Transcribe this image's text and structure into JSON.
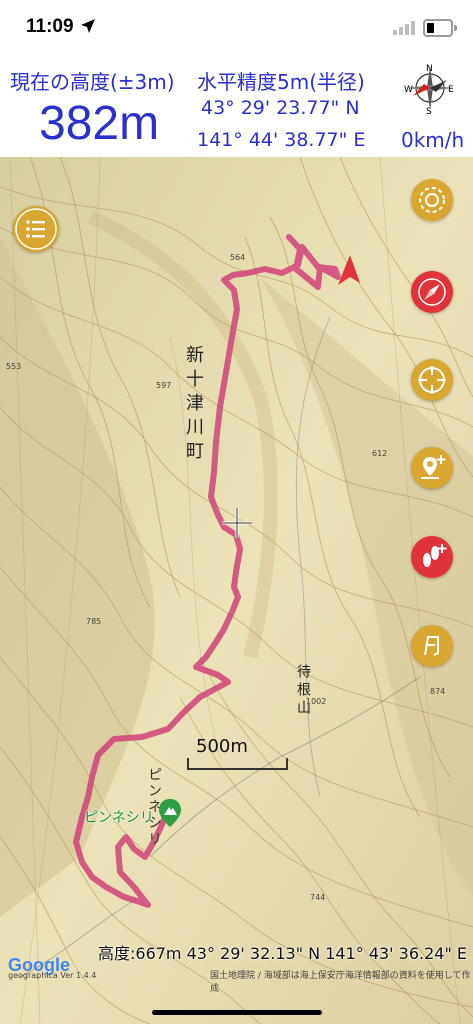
{
  "status_bar": {
    "time": "11:09"
  },
  "info": {
    "altitude_label": "現在の高度(±3m)",
    "altitude_value": "382m",
    "accuracy_label": "水平精度5m(半径)",
    "latitude": "43° 29' 23.77\" N",
    "longitude": "141° 44' 38.77\" E",
    "speed": "0km/h",
    "compass_letters": [
      "N",
      "E",
      "S",
      "W"
    ]
  },
  "map": {
    "town_label": "新十津川町",
    "mountain_label": "待根山",
    "peak_name": "ピンネシリ",
    "peak_name_vertical": "ピンネシリ",
    "scale_label": "500m",
    "elev_labels": [
      "564",
      "597",
      "612",
      "785",
      "1002",
      "874",
      "744",
      "553"
    ],
    "cursor_coords": "高度:667m  43° 29' 32.13\" N 141° 43' 36.24\" E",
    "google_logo": "Google",
    "app_version": "geographica Ver 1.4.4",
    "attribution": "国土地理院 / 海域部は海上保安庁海洋情報部の資料を使用して作成"
  },
  "buttons": {
    "menu": "menu",
    "icons": [
      "record-spiral-icon",
      "compass-icon",
      "locate-icon",
      "add-place-icon",
      "add-footprint-icon",
      "trail-icon"
    ]
  },
  "colors": {
    "accent_blue": "#2b2fd0",
    "fab_orange": "#d9a632",
    "fab_red": "#e0333a",
    "track_pink": "#d0427a",
    "map_base": "#e8ddb0"
  }
}
